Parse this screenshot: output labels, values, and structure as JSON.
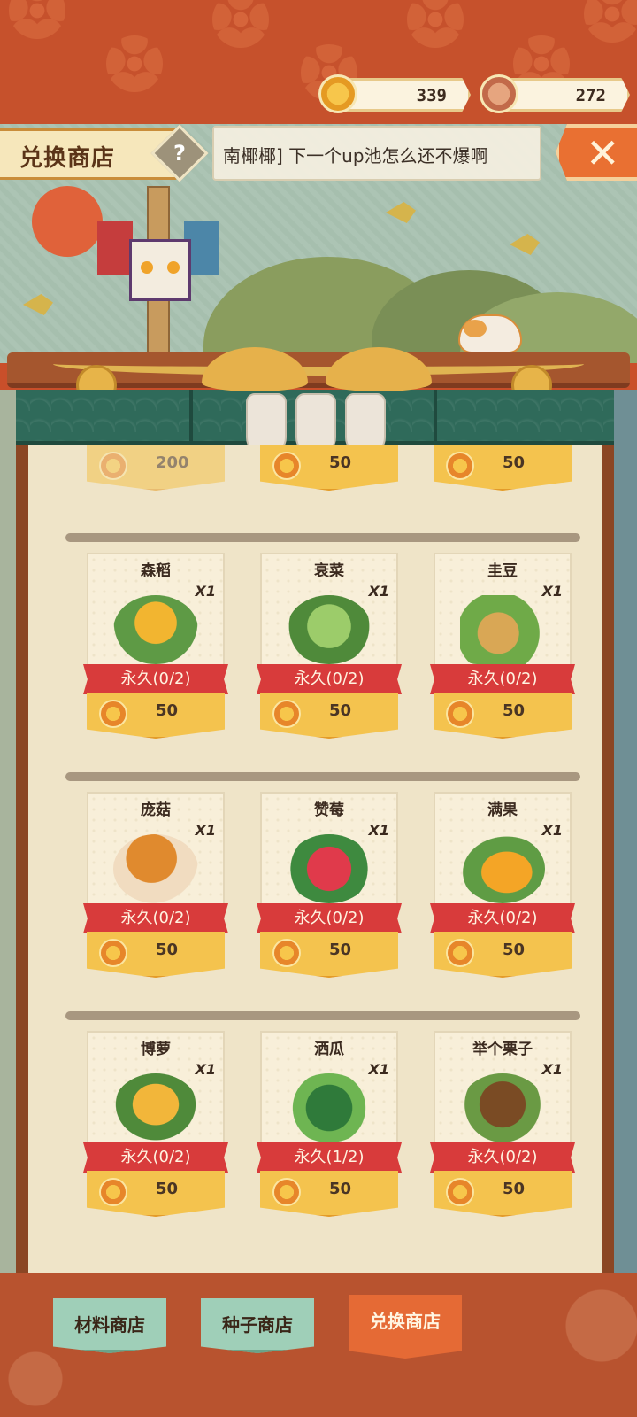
{
  "header": {
    "title": "兑换商店",
    "help_icon": "?",
    "announcement": "南椰椰] 下一个up池怎么还不爆啊",
    "close_icon": "✕"
  },
  "currencies": [
    {
      "icon": "gold-coin-icon",
      "value": "339"
    },
    {
      "icon": "copper-coin-icon",
      "value": "272"
    }
  ],
  "partial_row": [
    {
      "name": "",
      "price": "200"
    },
    {
      "name": "",
      "price": "50"
    },
    {
      "name": "",
      "price": "50"
    }
  ],
  "items": [
    {
      "name": "森稻",
      "qty": "X1",
      "limit": "永久(0/2)",
      "price": "50",
      "art": "rice-icon"
    },
    {
      "name": "衰菜",
      "qty": "X1",
      "limit": "永久(0/2)",
      "price": "50",
      "art": "cabbage-icon"
    },
    {
      "name": "圭豆",
      "qty": "X1",
      "limit": "永久(0/2)",
      "price": "50",
      "art": "bean-icon"
    },
    {
      "name": "庞菇",
      "qty": "X1",
      "limit": "永久(0/2)",
      "price": "50",
      "art": "mushroom-icon"
    },
    {
      "name": "赞莓",
      "qty": "X1",
      "limit": "永久(0/2)",
      "price": "50",
      "art": "strawberry-icon"
    },
    {
      "name": "满果",
      "qty": "X1",
      "limit": "永久(0/2)",
      "price": "50",
      "art": "mango-icon"
    },
    {
      "name": "博萝",
      "qty": "X1",
      "limit": "永久(0/2)",
      "price": "50",
      "art": "pineapple-icon"
    },
    {
      "name": "洒瓜",
      "qty": "X1",
      "limit": "永久(1/2)",
      "price": "50",
      "art": "watermelon-icon"
    },
    {
      "name": "举个栗子",
      "qty": "X1",
      "limit": "永久(0/2)",
      "price": "50",
      "art": "chestnut-icon"
    }
  ],
  "nav": {
    "material": "材料商店",
    "seed": "种子商店",
    "exchange": "兑换商店"
  },
  "colors": {
    "accent_red": "#d83b3b",
    "gold": "#f4c34e",
    "teal": "#2f6a5a",
    "active_tab": "#e56a35"
  }
}
